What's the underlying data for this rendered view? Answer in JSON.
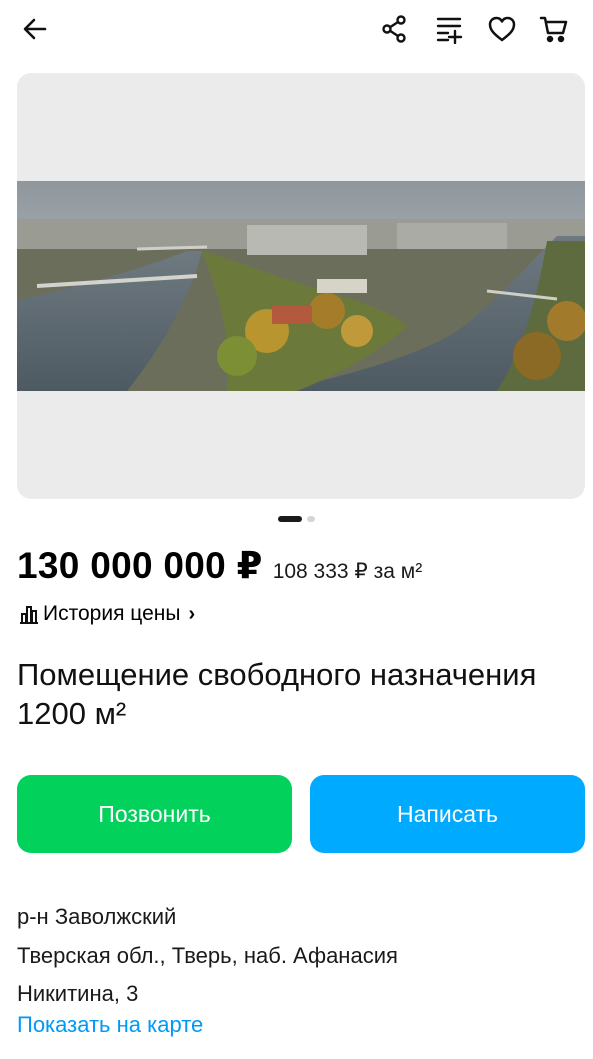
{
  "header": {
    "icons": [
      "back-arrow-icon",
      "share-icon",
      "compare-icon",
      "heart-icon",
      "cart-icon"
    ]
  },
  "gallery": {
    "photo_description_icon": "city-river-photo",
    "page_count": 2,
    "current_page": 1
  },
  "listing": {
    "price": "130 000 000 ₽",
    "price_per_m2": "108 333 ₽ за м²",
    "price_history_label": "История цены",
    "title": "Помещение свободного назначения 1200 м²"
  },
  "actions": {
    "call_label": "Позвонить",
    "write_label": "Написать"
  },
  "address": {
    "district": "р-н Заволжский",
    "line1": "Тверская обл., Тверь, наб. Афанасия",
    "line2": "Никитина, 3",
    "map_link": "Показать на карте"
  },
  "colors": {
    "call_button": "#02d15c",
    "write_button": "#00aaff",
    "link": "#0099f7"
  }
}
